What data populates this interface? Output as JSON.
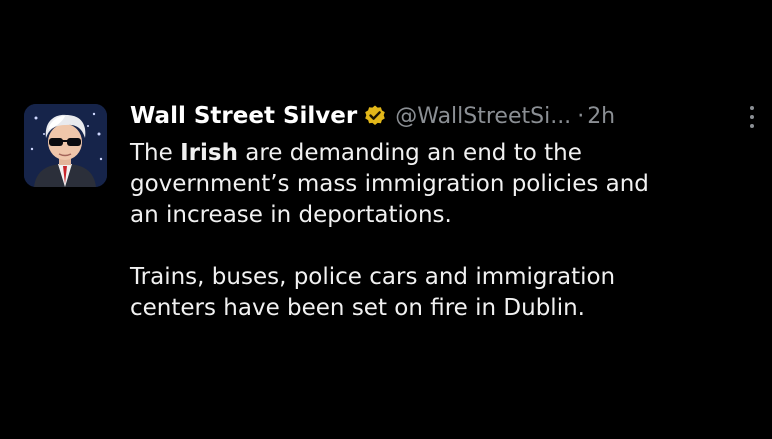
{
  "tweet": {
    "author": {
      "display_name": "Wall Street Silver",
      "handle": "@WallStreetSi...",
      "verified_badge": "gold-checkmark-badge",
      "avatar_icon": "silver-haired-man-with-sunglasses-avatar"
    },
    "timestamp_separator": "·",
    "timestamp": "2h",
    "more_icon": "vertical-ellipsis-icon",
    "body": {
      "paragraph1_pre": "The ",
      "paragraph1_bold": "Irish",
      "paragraph1_line1_rest": " are demanding an end to the",
      "paragraph1_line2": "government’s mass immigration policies and",
      "paragraph1_line3": "an increase in deportations.",
      "paragraph2_line1": "Trains, buses, police cars and immigration",
      "paragraph2_line2": "centers have been set on fire in Dublin."
    }
  },
  "colors": {
    "background": "#000000",
    "primary_text": "#e7e9ea",
    "secondary_text": "#8b8f94",
    "verified_gold": "#e2b719"
  }
}
